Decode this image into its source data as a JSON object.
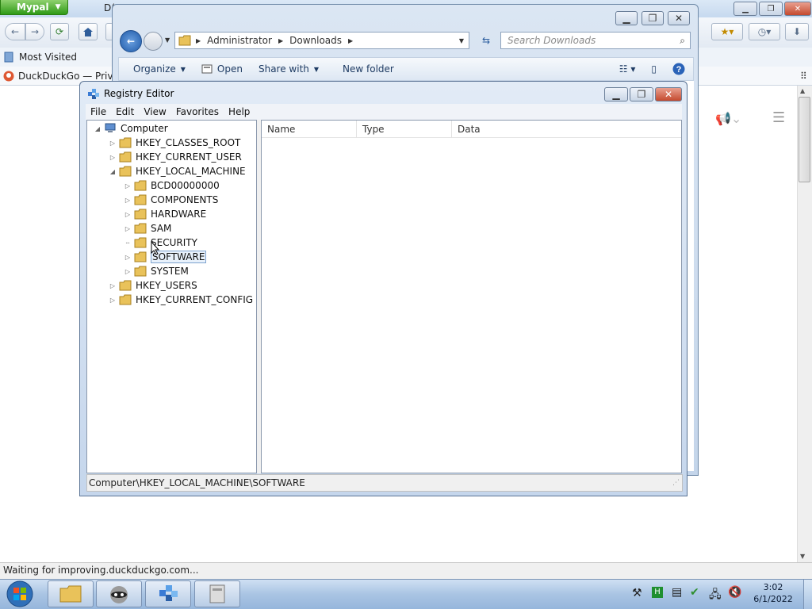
{
  "browser": {
    "menu_label": "Mypal",
    "tab_partial": "D(",
    "bookmarks": {
      "most_visited": "Most Visited"
    },
    "tab_label": "DuckDuckGo — Privac",
    "status": "Waiting for improving.duckduckgo.com..."
  },
  "explorer": {
    "breadcrumb": [
      "Administrator",
      "Downloads"
    ],
    "search_placeholder": "Search Downloads",
    "toolbar": {
      "organize": "Organize",
      "open": "Open",
      "share_with": "Share with",
      "new_folder": "New folder"
    }
  },
  "regedit": {
    "title": "Registry Editor",
    "menu": {
      "file": "File",
      "edit": "Edit",
      "view": "View",
      "favorites": "Favorites",
      "help": "Help"
    },
    "tree": {
      "computer": "Computer",
      "hkcr": "HKEY_CLASSES_ROOT",
      "hkcu": "HKEY_CURRENT_USER",
      "hklm": "HKEY_LOCAL_MACHINE",
      "bcd": "BCD00000000",
      "components": "COMPONENTS",
      "hardware": "HARDWARE",
      "sam": "SAM",
      "security": "SECURITY",
      "software": "SOFTWARE",
      "system": "SYSTEM",
      "hku": "HKEY_USERS",
      "hkcc": "HKEY_CURRENT_CONFIG"
    },
    "columns": {
      "name": "Name",
      "type": "Type",
      "data": "Data"
    },
    "status_path": "Computer\\HKEY_LOCAL_MACHINE\\SOFTWARE"
  },
  "taskbar": {
    "time": "3:02",
    "date": "6/1/2022"
  },
  "colors": {
    "folder": "#e9c25a",
    "selection_border": "#7da2ce",
    "taskbar": "#a9c4e3"
  }
}
